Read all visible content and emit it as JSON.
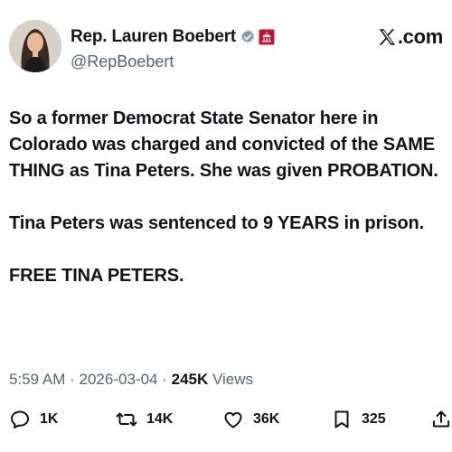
{
  "author": {
    "display_name": "Rep. Lauren Boebert",
    "handle": "@RepBoebert",
    "verified_icon": "verified-badge-icon",
    "affiliation_icon": "government-affiliation-icon"
  },
  "brand": {
    "label": ".com",
    "icon": "x-logo-icon"
  },
  "post": {
    "paragraphs": [
      "So a former Democrat State Senator here in Colorado was charged and convicted of the SAME THING as Tina Peters. She was given PROBATION.",
      "Tina Peters was sentenced to 9 YEARS in prison.",
      "FREE TINA PETERS."
    ]
  },
  "meta": {
    "time": "5:59 AM",
    "date": "2026-03-04",
    "views_count": "245K",
    "views_label": "Views",
    "separator": "·"
  },
  "actions": {
    "replies": "1K",
    "reposts": "14K",
    "likes": "36K",
    "bookmarks": "325"
  },
  "colors": {
    "text": "#0f1419",
    "secondary": "#536471",
    "verified": "#829aab",
    "affiliation": "#c8102e"
  }
}
